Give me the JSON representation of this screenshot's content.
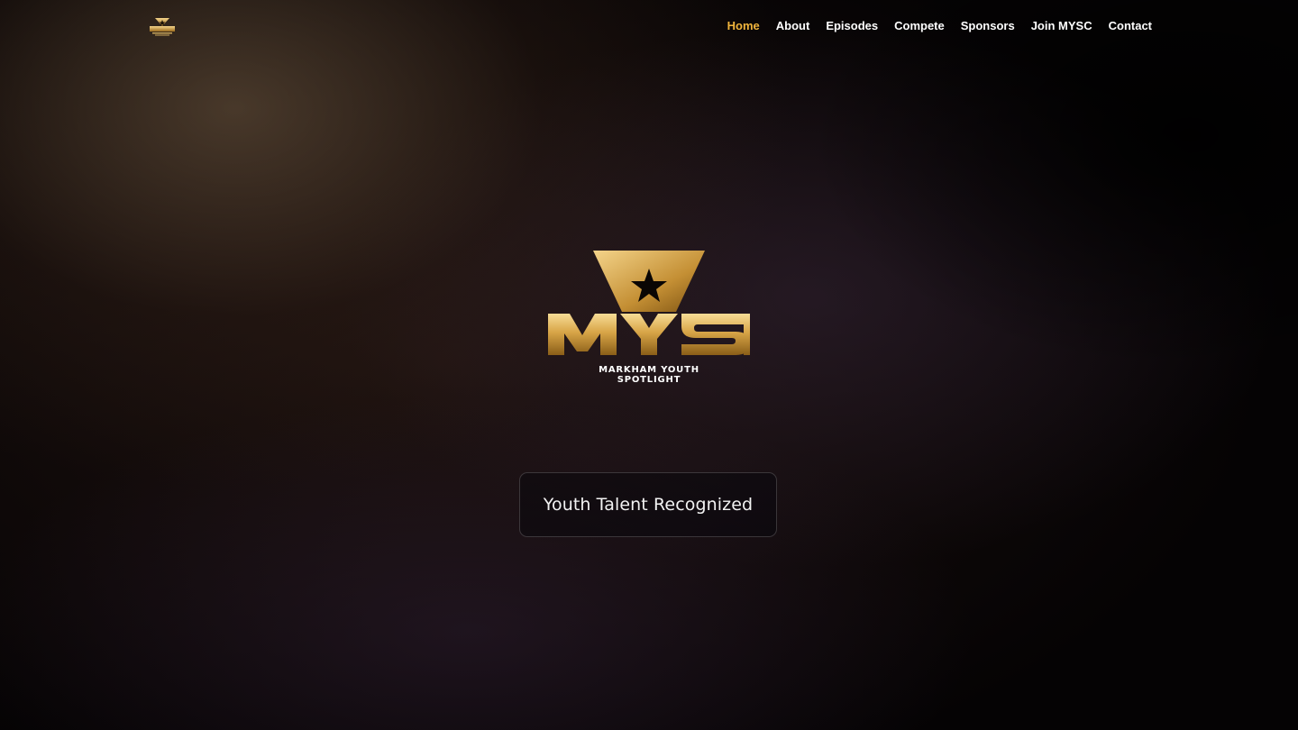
{
  "header": {
    "logo_icon": "mysl-logo-icon",
    "nav": [
      {
        "label": "Home",
        "active": true
      },
      {
        "label": "About",
        "active": false
      },
      {
        "label": "Episodes",
        "active": false
      },
      {
        "label": "Compete",
        "active": false
      },
      {
        "label": "Sponsors",
        "active": false
      },
      {
        "label": "Join MYSC",
        "active": false
      },
      {
        "label": "Contact",
        "active": false
      }
    ]
  },
  "hero": {
    "logo_wordmark": "MYS",
    "logo_caption_line1": "MARKHAM YOUTH",
    "logo_caption_line2": "SPOTLIGHT",
    "tagline": "Youth Talent Recognized"
  },
  "colors": {
    "accent": "#f0b43c",
    "gold_light": "#f4d48a",
    "gold_dark": "#9a6a1c",
    "nav_text": "#ffffff",
    "background": "#050304"
  }
}
